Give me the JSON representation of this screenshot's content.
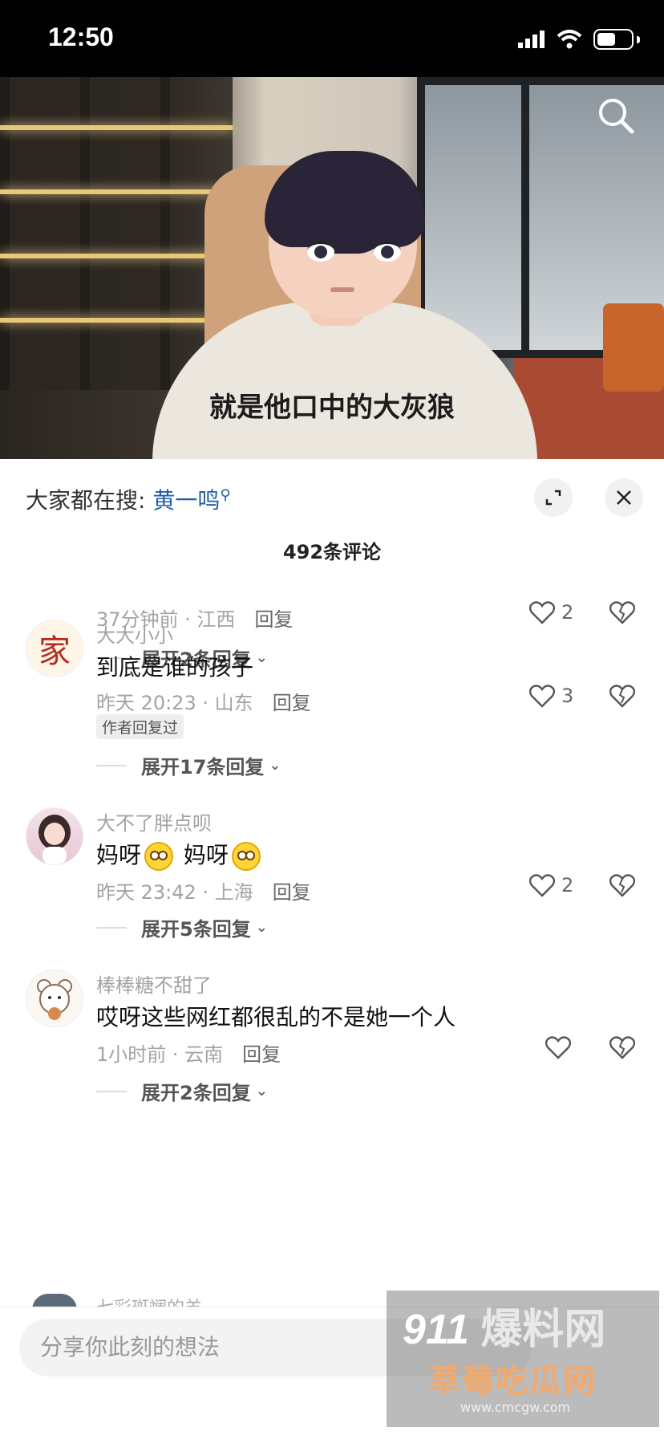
{
  "status": {
    "time": "12:50"
  },
  "video": {
    "subtitle": "就是他口中的大灰狼"
  },
  "sheet": {
    "hot_search_label": "大家都在搜:",
    "hot_search_keyword": "黄一鸣",
    "comment_count": "492条评论"
  },
  "comments": [
    {
      "username": "",
      "meta": "37分钟前 · 江西",
      "reply_label": "回复",
      "likes": "2",
      "expand": "展开2条回复"
    },
    {
      "username": "大大小小",
      "text": "到底是谁的孩子",
      "meta": "昨天 20:23 · 山东",
      "reply_label": "回复",
      "likes": "3",
      "badge": "作者回复过",
      "expand": "展开17条回复",
      "avatar_char": "家"
    },
    {
      "username": "大不了胖点呗",
      "text_part1": "妈呀",
      "text_part2": "妈呀",
      "meta": "昨天 23:42 · 上海",
      "reply_label": "回复",
      "likes": "2",
      "expand": "展开5条回复"
    },
    {
      "username": "棒棒糖不甜了",
      "text": "哎呀这些网红都很乱的不是她一个人",
      "meta": "1小时前 · 云南",
      "reply_label": "回复",
      "likes": "",
      "expand": "展开2条回复"
    }
  ],
  "peek_comment": {
    "username": "七彩斑斓的羊"
  },
  "input": {
    "placeholder": "分享你此刻的想法"
  },
  "watermark": {
    "logo": "911",
    "logo_text": "爆料网",
    "sub": "草莓吃瓜网",
    "url": "www.cmcgw.com"
  }
}
